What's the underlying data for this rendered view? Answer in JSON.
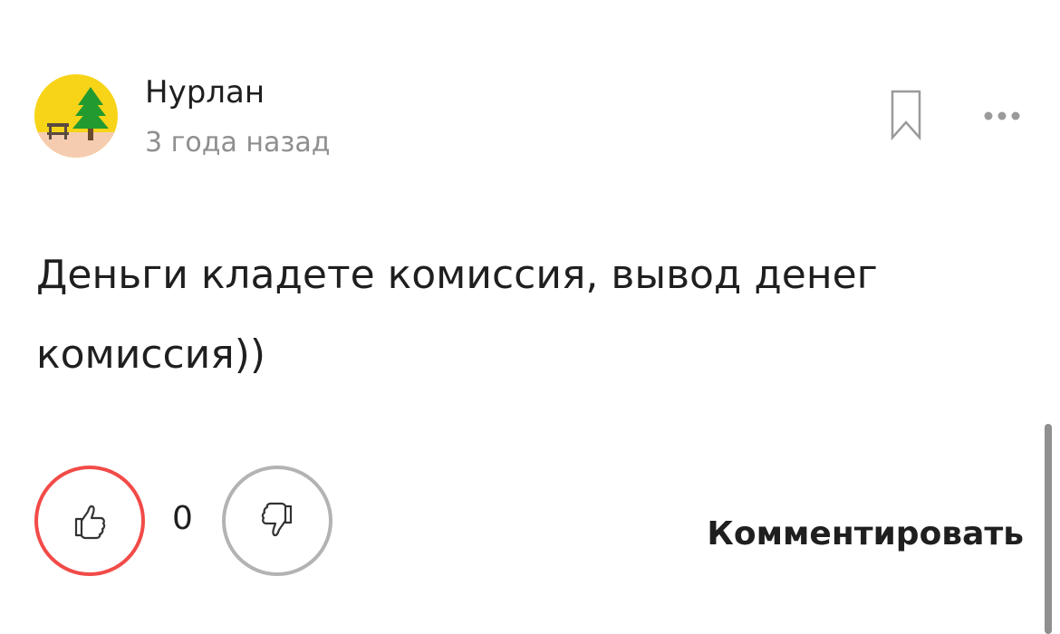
{
  "comment": {
    "author": "Нурлан",
    "timestamp": "3 года назад",
    "text": "Деньги кладете комиссия, вывод денег комиссия))",
    "avatar_icon": "pine-tree-bench-icon"
  },
  "actions": {
    "rating": "0",
    "reply_label": "Комментировать",
    "like_icon": "thumbs-up-icon",
    "dislike_icon": "thumbs-down-icon",
    "bookmark_icon": "bookmark-icon",
    "more_icon": "more-dots-icon"
  },
  "colors": {
    "like_border": "#f24b48",
    "dislike_border": "#b3b3b3",
    "avatar_yellow": "#f8d418",
    "avatar_tree": "#239a2f",
    "secondary_text": "#8f8f8f"
  }
}
